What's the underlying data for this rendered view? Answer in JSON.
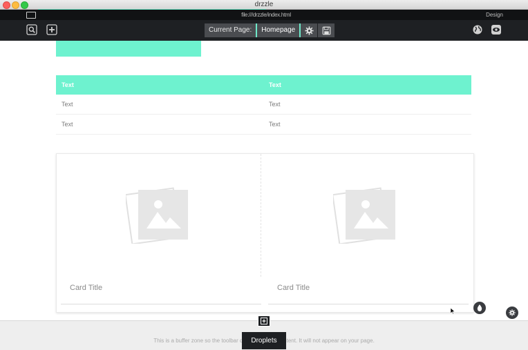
{
  "window": {
    "title": "drzzle"
  },
  "strip": {
    "center_text": "file:///drzzle/index.html",
    "right_text": "Design"
  },
  "toolbar": {
    "current_page_label": "Current Page:",
    "current_page_value": "Homepage",
    "left_icons": [
      "zoom-icon",
      "add-page-icon"
    ],
    "right_icons": [
      "globe-icon",
      "eye-icon"
    ],
    "accent": "#6ee9c9"
  },
  "table": {
    "headers": [
      "Text",
      "Text"
    ],
    "rows": [
      [
        "Text",
        "Text"
      ],
      [
        "Text",
        "Text"
      ]
    ],
    "header_color": "#6ef2cf"
  },
  "cards": [
    {
      "title": "Card Title"
    },
    {
      "title": "Card Title"
    }
  ],
  "buffer": {
    "text": "This is a buffer zone so the toolbar does not cover content. It will not appear on your page."
  },
  "droplets": {
    "label": "Droplets"
  }
}
